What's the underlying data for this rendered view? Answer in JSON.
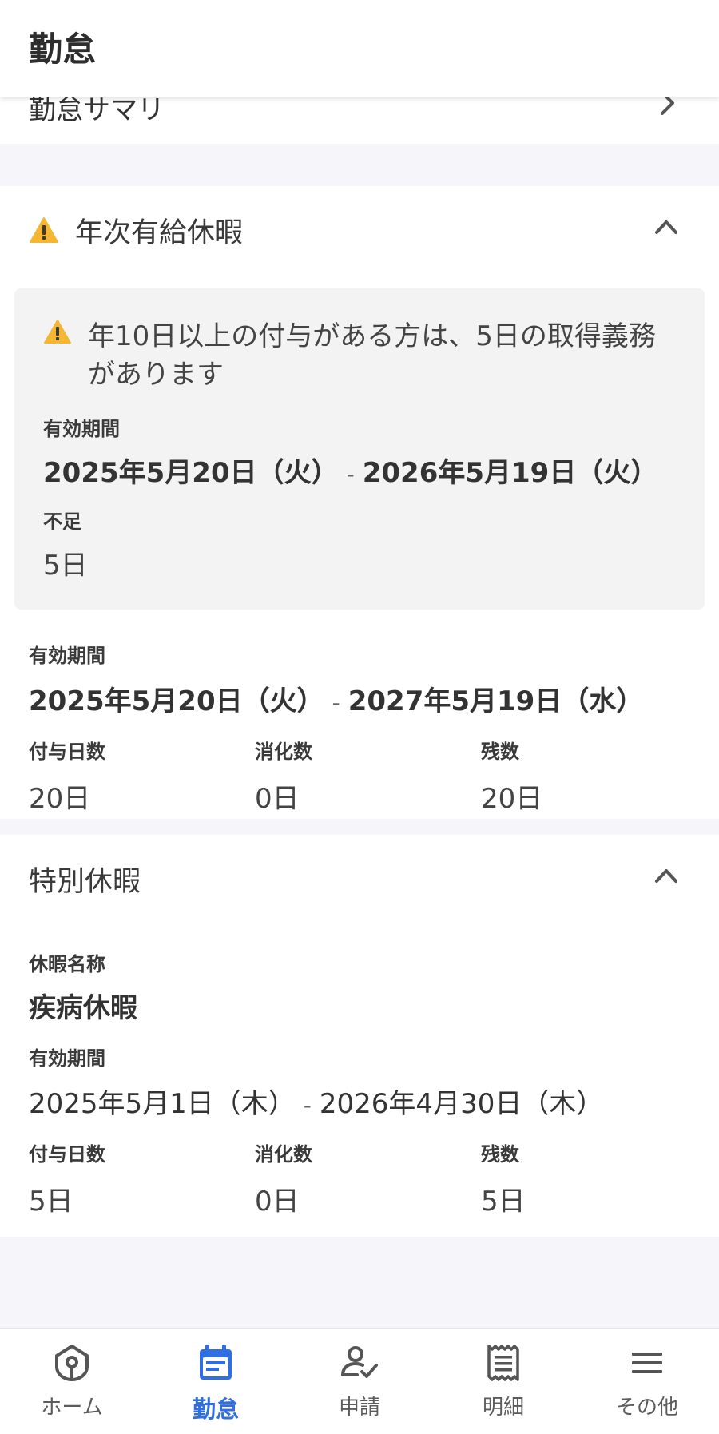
{
  "header": {
    "title": "勤怠"
  },
  "summary_row": {
    "label": "勤怠サマリ"
  },
  "annual_leave": {
    "title": "年次有給休暇",
    "warning": {
      "message": "年10日以上の付与がある方は、5日の取得義務があります",
      "period_label": "有効期間",
      "period_start": "2025年5月20日（火）",
      "period_sep": "-",
      "period_end": "2026年5月19日（火）",
      "shortage_label": "不足",
      "shortage_value": "5日"
    },
    "grant": {
      "period_label": "有効期間",
      "period_start": "2025年5月20日（火）",
      "period_sep": "-",
      "period_end": "2027年5月19日（水）",
      "granted_label": "付与日数",
      "granted_value": "20日",
      "used_label": "消化数",
      "used_value": "0日",
      "remaining_label": "残数",
      "remaining_value": "20日"
    }
  },
  "special_leave": {
    "title": "特別休暇",
    "name_label": "休暇名称",
    "name_value": "疾病休暇",
    "period_label": "有効期間",
    "period_start": "2025年5月1日（木）",
    "period_sep": "-",
    "period_end": "2026年4月30日（木）",
    "granted_label": "付与日数",
    "granted_value": "5日",
    "used_label": "消化数",
    "used_value": "0日",
    "remaining_label": "残数",
    "remaining_value": "5日"
  },
  "bottom_nav": {
    "items": [
      {
        "label": "ホーム",
        "icon": "home-icon"
      },
      {
        "label": "勤怠",
        "icon": "calendar-icon",
        "active": true
      },
      {
        "label": "申請",
        "icon": "person-check-icon"
      },
      {
        "label": "明細",
        "icon": "receipt-icon"
      },
      {
        "label": "その他",
        "icon": "menu-icon"
      }
    ]
  },
  "colors": {
    "accent": "#2f6fe3",
    "warning": "#f5b733",
    "background": "#f6f6fa"
  }
}
